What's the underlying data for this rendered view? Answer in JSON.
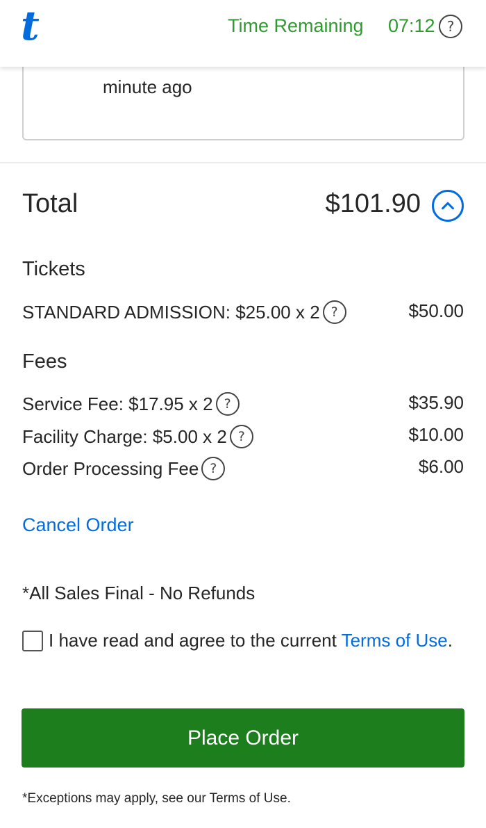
{
  "header": {
    "logo": "t",
    "timer_label": "Time Remaining",
    "timer_value": "07:12",
    "help_symbol": "?"
  },
  "notice": {
    "text": "minute ago"
  },
  "total": {
    "label": "Total",
    "value": "$101.90"
  },
  "tickets": {
    "title": "Tickets",
    "items": [
      {
        "label": "STANDARD ADMISSION: $25.00 x 2",
        "amount": "$50.00"
      }
    ]
  },
  "fees": {
    "title": "Fees",
    "items": [
      {
        "label": "Service Fee: $17.95 x 2",
        "amount": "$35.90"
      },
      {
        "label": "Facility Charge: $5.00 x 2",
        "amount": "$10.00"
      },
      {
        "label": "Order Processing Fee",
        "amount": "$6.00"
      }
    ]
  },
  "actions": {
    "cancel_label": "Cancel Order",
    "place_order_label": "Place Order"
  },
  "terms": {
    "sales_final": "*All Sales Final - No Refunds",
    "agree_prefix": "I have read and agree to the current ",
    "terms_link": "Terms of Use",
    "agree_suffix": ".",
    "checked": false,
    "footnote": "*Exceptions may apply, see our Terms of Use."
  },
  "colors": {
    "brand_blue": "#026cdf",
    "timer_green": "#2e9b2e",
    "button_green": "#1c7e1c"
  },
  "icons": {
    "help": "question-circle-icon",
    "collapse": "chevron-up-icon"
  }
}
